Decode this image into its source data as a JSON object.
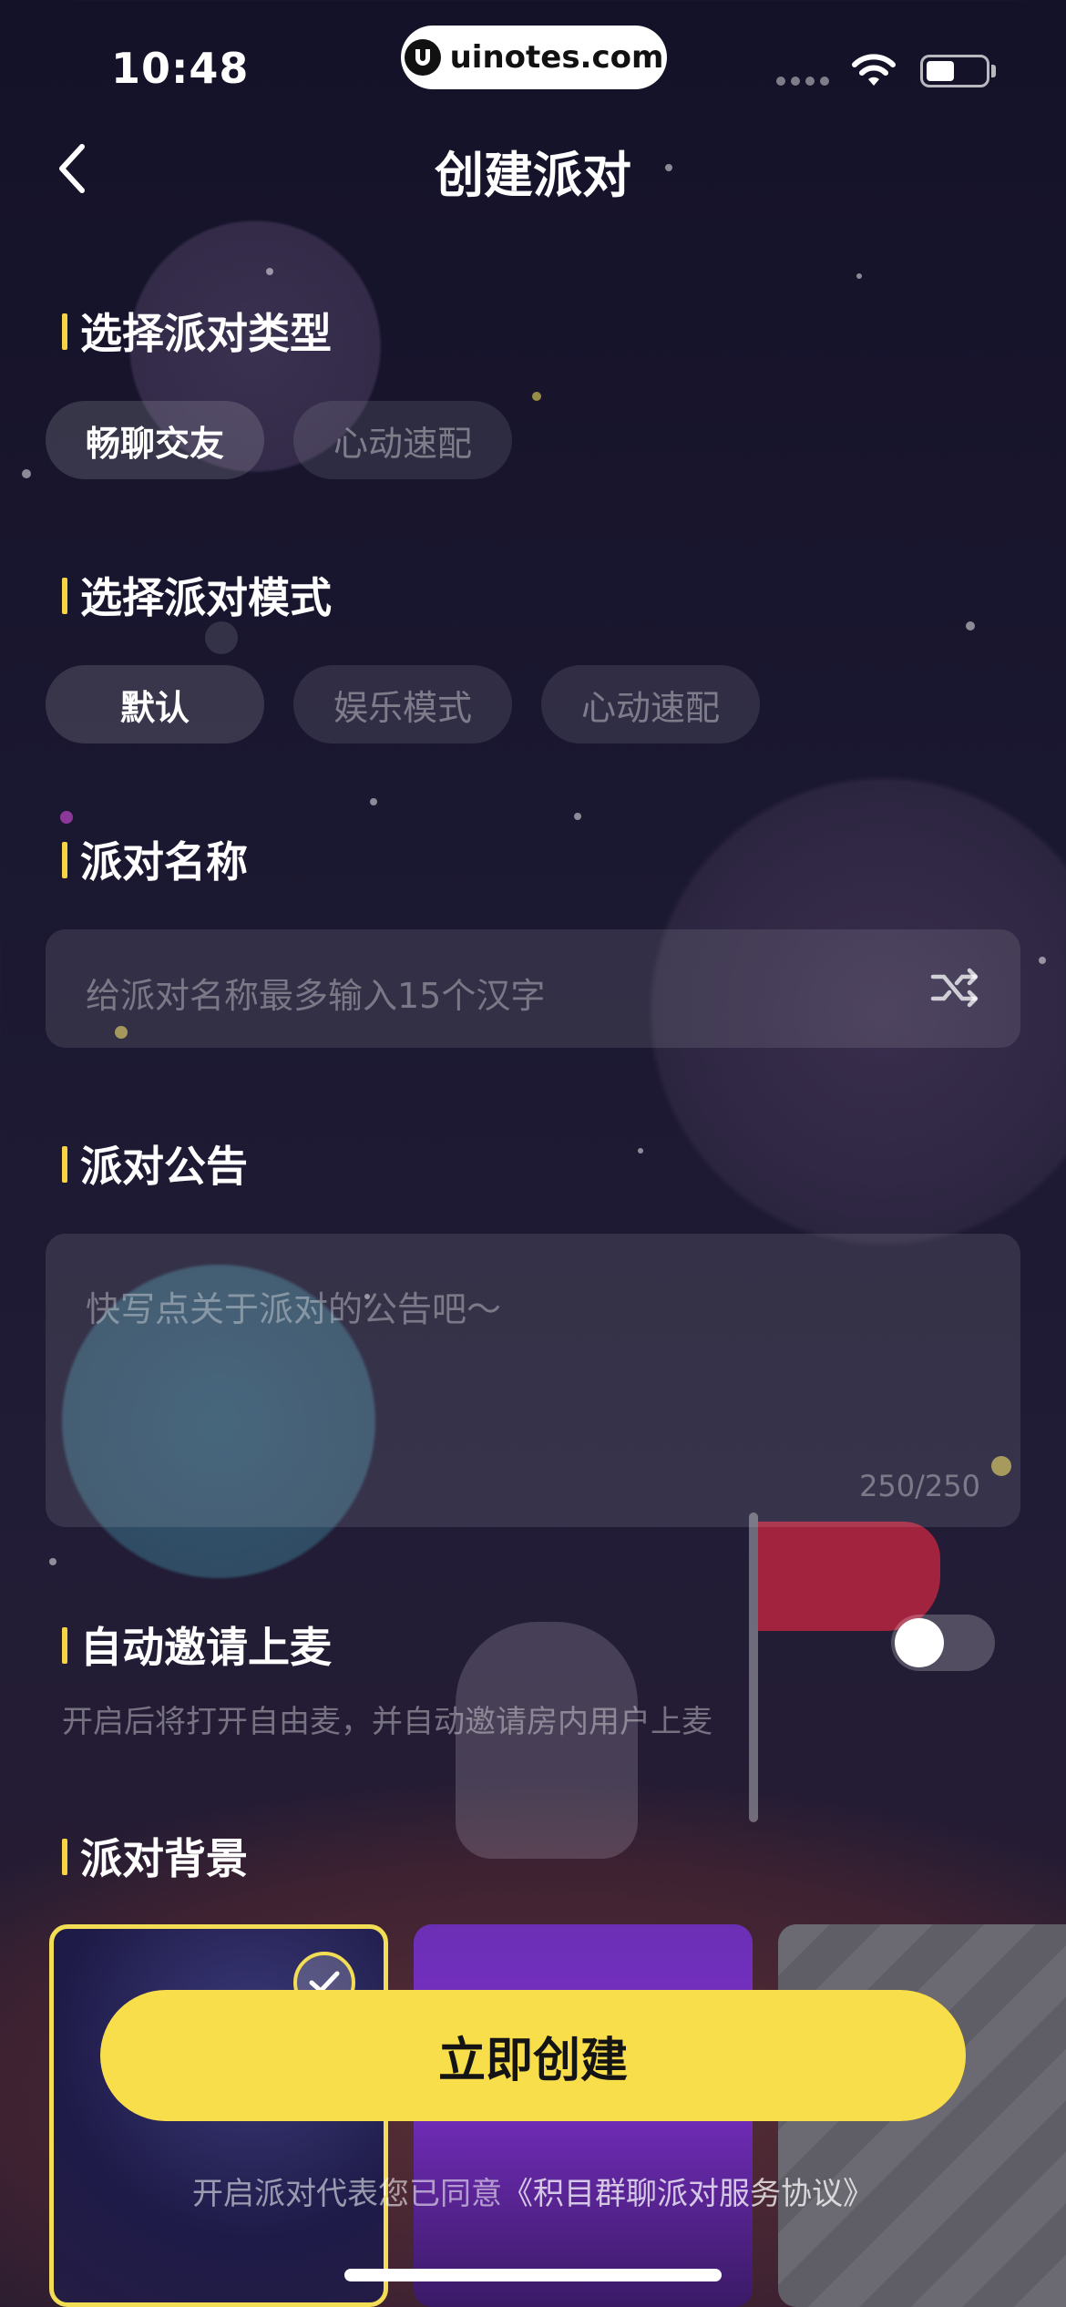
{
  "status_bar": {
    "time": "10:48",
    "watermark": "uinotes.com"
  },
  "nav": {
    "title": "创建派对"
  },
  "party_type": {
    "title": "选择派对类型",
    "options": [
      "畅聊交友",
      "心动速配"
    ],
    "selected_index": 0
  },
  "party_mode": {
    "title": "选择派对模式",
    "options": [
      "默认",
      "娱乐模式",
      "心动速配"
    ],
    "selected_index": 0
  },
  "party_name": {
    "title": "派对名称",
    "placeholder": "给派对名称最多输入15个汉字"
  },
  "announcement": {
    "title": "派对公告",
    "placeholder": "快写点关于派对的公告吧～",
    "counter": "250/250"
  },
  "auto_invite": {
    "title": "自动邀请上麦",
    "description": "开启后将打开自由麦，并自动邀请房内用户上麦",
    "enabled": false
  },
  "background": {
    "title": "派对背景",
    "selected_index": 0
  },
  "actions": {
    "create_label": "立即创建",
    "agreement_prefix": "开启派对代表您已同意",
    "agreement_link": "《积目群聊派对服务协议》"
  },
  "colors": {
    "accent": "#f9de4b",
    "background": "#1a1730"
  }
}
